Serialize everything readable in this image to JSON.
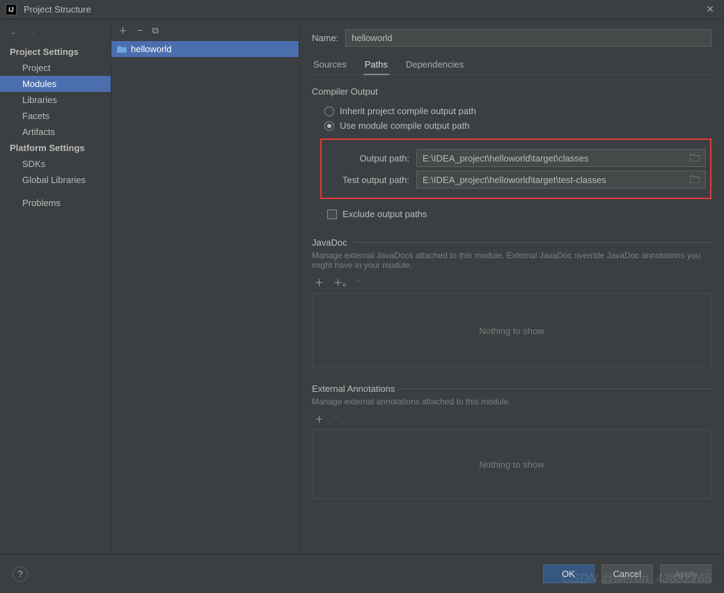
{
  "window": {
    "title": "Project Structure"
  },
  "sidebar": {
    "section1": "Project Settings",
    "items1": {
      "project": "Project",
      "modules": "Modules",
      "libraries": "Libraries",
      "facets": "Facets",
      "artifacts": "Artifacts"
    },
    "section2": "Platform Settings",
    "items2": {
      "sdks": "SDKs",
      "global_libraries": "Global Libraries"
    },
    "problems": "Problems"
  },
  "module_list": {
    "items": [
      {
        "name": "helloworld"
      }
    ]
  },
  "details": {
    "name_label": "Name:",
    "name_value": "helloworld",
    "tabs": {
      "sources": "Sources",
      "paths": "Paths",
      "dependencies": "Dependencies"
    },
    "compiler_output": {
      "title": "Compiler Output",
      "inherit": "Inherit project compile output path",
      "use_module": "Use module compile output path",
      "output_label": "Output path:",
      "output_value": "E:\\IDEA_project\\helloworld\\target\\classes",
      "test_output_label": "Test output path:",
      "test_output_value": "E:\\IDEA_project\\helloworld\\target\\test-classes",
      "exclude": "Exclude output paths"
    },
    "javadoc": {
      "title": "JavaDoc",
      "desc": "Manage external JavaDocs attached to this module. External JavaDoc override JavaDoc annotations you might have in your module.",
      "empty": "Nothing to show"
    },
    "external_annotations": {
      "title": "External Annotations",
      "desc": "Manage external annotations attached to this module.",
      "empty": "Nothing to show"
    }
  },
  "footer": {
    "ok": "OK",
    "cancel": "Cancel",
    "apply": "Apply"
  },
  "watermark": "CSDN @weixin_43882265"
}
